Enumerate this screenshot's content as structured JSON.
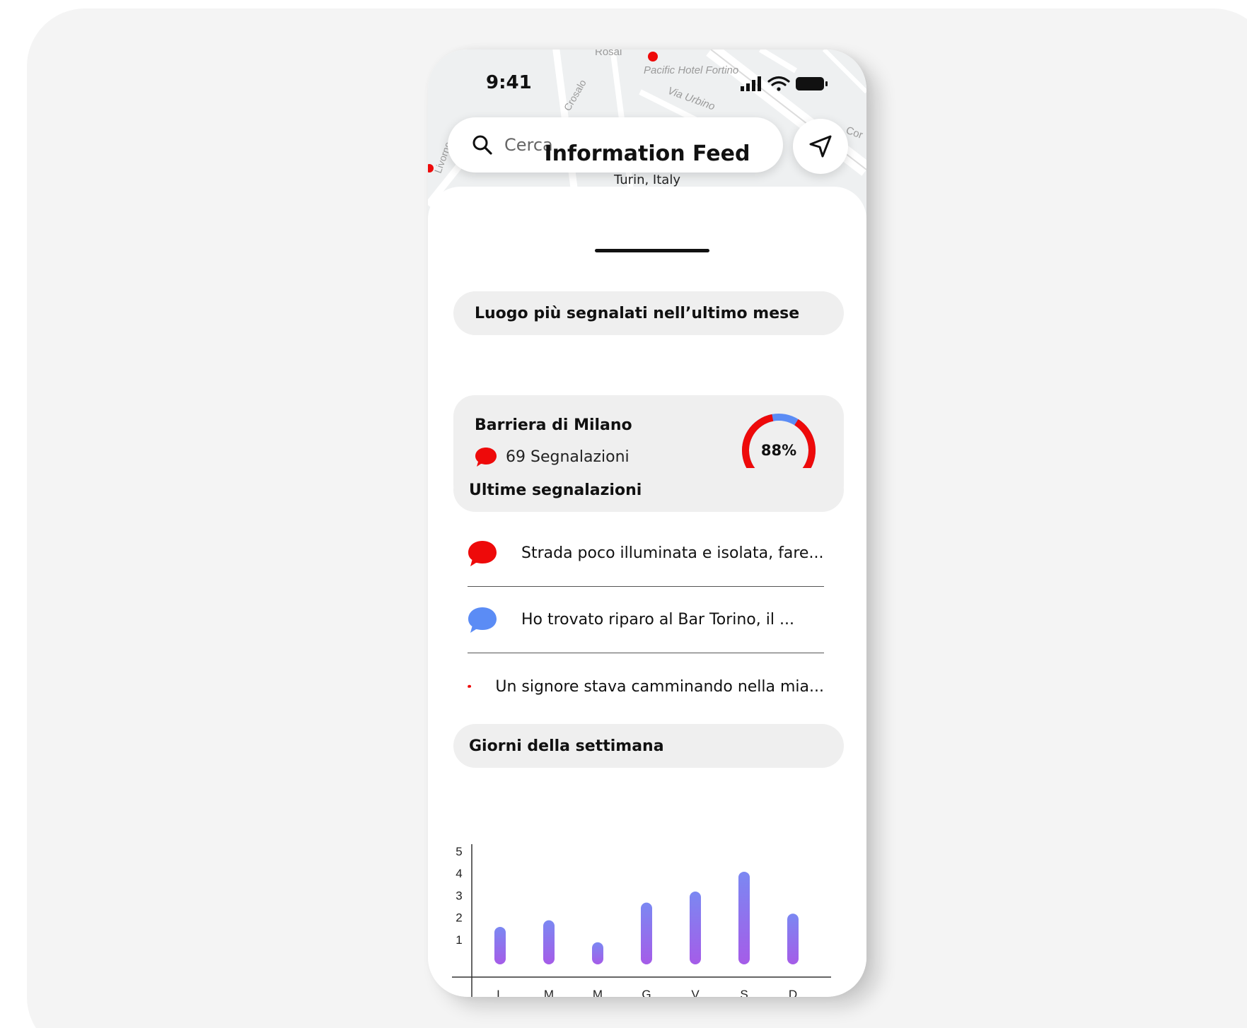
{
  "status_bar": {
    "time": "9:41"
  },
  "map": {
    "labels": [
      "Pacific Hotel Fortino",
      "Via Urbino",
      "Livorno",
      "Crosalo",
      "Rosai",
      "Cor"
    ]
  },
  "search": {
    "placeholder": "Cerca"
  },
  "icons": {
    "search": "search-icon",
    "locate": "navigation-arrow-icon",
    "report": "speech-bubble-icon",
    "signal": "signal-bars-icon",
    "wifi": "wifi-icon",
    "battery": "battery-icon"
  },
  "colors": {
    "red": "#ee0a0a",
    "blue": "#5b8cf5",
    "bar_top": "#7b88f2",
    "bar_bottom": "#a55ce8"
  },
  "feed": {
    "title": "Information Feed",
    "subtitle": "Turin, Italy"
  },
  "most_reported": {
    "heading": "Luogo più segnalati nell’ultimo mese",
    "place": "Barriera di Milano",
    "count_label": "69 Segnalazioni",
    "percent_label": "88%",
    "percent": 88
  },
  "latest": {
    "heading": "Ultime segnalazioni",
    "items": [
      {
        "text": "Strada poco illuminata e isolata, fare...",
        "color": "#ee0a0a"
      },
      {
        "text": "Ho trovato riparo al Bar Torino, il ...",
        "color": "#5b8cf5"
      },
      {
        "text": "Un signore stava camminando nella mia...",
        "color": "#ee0a0a"
      }
    ]
  },
  "weekdays": {
    "heading": "Giorni della settimana"
  },
  "chart_data": {
    "type": "bar",
    "categories": [
      "L",
      "M",
      "M",
      "G",
      "V",
      "S",
      "D"
    ],
    "values": [
      1.7,
      2.0,
      1.0,
      2.8,
      3.3,
      4.2,
      2.3
    ],
    "y_ticks": [
      1,
      2,
      3,
      4,
      5
    ],
    "ylim": [
      0,
      5
    ],
    "title": "",
    "xlabel": "",
    "ylabel": ""
  }
}
